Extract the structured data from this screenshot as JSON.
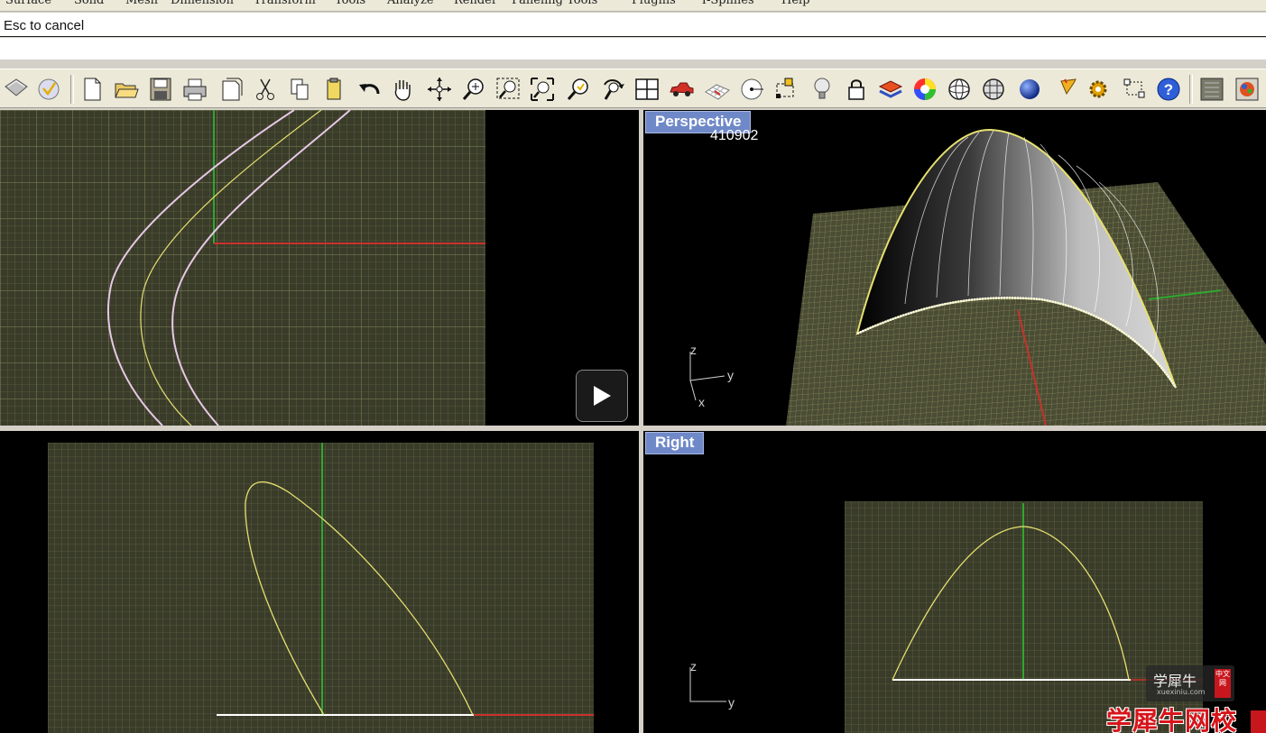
{
  "menubar": {
    "items": [
      "Surface",
      "Solid",
      "Mesh",
      "Dimension",
      "Transform",
      "Tools",
      "Analyze",
      "Render",
      "Paneling Tools",
      "Plugins",
      "T-Splines",
      "Help"
    ]
  },
  "command": {
    "prompt": "Esc to cancel",
    "input_value": ""
  },
  "toolbar": {
    "buttons": [
      "select-filter",
      "osnap",
      "new",
      "open",
      "save",
      "print",
      "properties",
      "cut",
      "copy",
      "paste",
      "undo",
      "pan",
      "rotate-view",
      "zoom-dynamic",
      "zoom-window",
      "zoom-extents",
      "zoom-selected",
      "rotate-3d",
      "four-viewports",
      "car",
      "grid-plane",
      "circle-point",
      "bounding-box",
      "light",
      "lock",
      "layer",
      "color-wheel",
      "render-sphere",
      "mesh-sphere",
      "shaded-sphere",
      "cone-tool",
      "gear",
      "connect",
      "help",
      "panel",
      "render-palette"
    ]
  },
  "viewports": {
    "top": {
      "label": ""
    },
    "perspective": {
      "label": "Perspective",
      "number": "410902",
      "axis_z": "z",
      "axis_y": "y",
      "axis_x": "x"
    },
    "front": {
      "label": ""
    },
    "right": {
      "label": "Right",
      "axis_z": "z",
      "axis_y": "y"
    }
  },
  "colors": {
    "grid": "#7a7d52",
    "x_axis": "#c8322a",
    "y_axis": "#2ea82e",
    "curve_yellow": "#e6e070",
    "curve_pink": "#e6c8e6",
    "viewport_label_bg": "#6f89c8"
  },
  "watermark": {
    "small_text": "学犀牛",
    "small_url": "xuexiniu.com",
    "badge": "中文网",
    "big_text": "学犀牛网校"
  }
}
